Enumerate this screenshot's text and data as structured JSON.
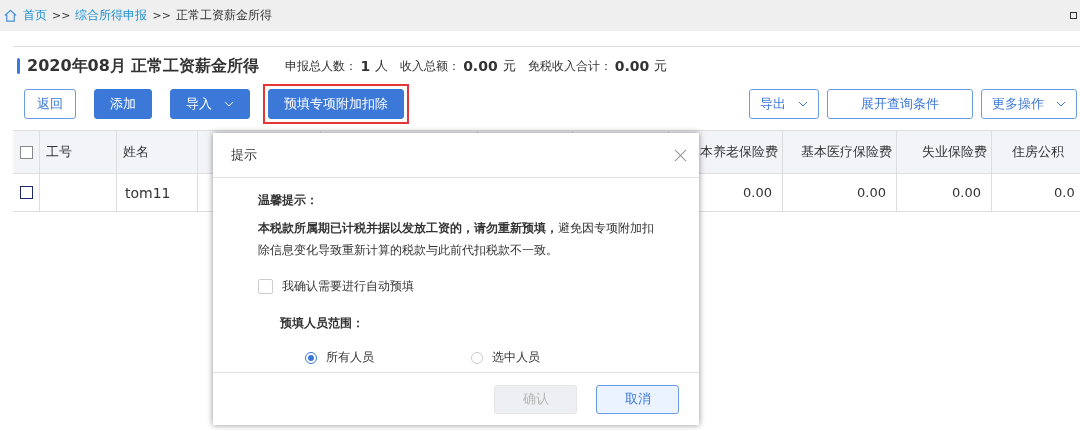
{
  "breadcrumb": [
    {
      "label": "首页",
      "link": true
    },
    {
      "label": "综合所得申报",
      "link": true
    },
    {
      "label": "正常工资薪金所得",
      "link": false
    }
  ],
  "breadcrumb_separator": ">>",
  "title": "2020年08月 正常工资薪金所得",
  "stats": [
    {
      "label": "申报总人数：",
      "value": "1",
      "unit": "人"
    },
    {
      "label": "收入总额：",
      "value": "0.00",
      "unit": "元"
    },
    {
      "label": "免税收入合计：",
      "value": "0.00",
      "unit": "元"
    }
  ],
  "left_buttons": [
    {
      "label": "返回",
      "kind": "outline",
      "dropdown": false,
      "highlighted": false
    },
    {
      "label": "添加",
      "kind": "primary",
      "dropdown": false,
      "highlighted": false
    },
    {
      "label": "导入",
      "kind": "primary",
      "dropdown": true,
      "highlighted": false
    },
    {
      "label": "预填专项附加扣除",
      "kind": "primary",
      "dropdown": false,
      "highlighted": true
    }
  ],
  "right_buttons": [
    {
      "label": "导出",
      "dropdown": true
    },
    {
      "label": "展开查询条件",
      "dropdown": false
    },
    {
      "label": "更多操作",
      "dropdown": true
    }
  ],
  "table": {
    "header_checked": false,
    "columns": [
      {
        "label": "工号"
      },
      {
        "label": "姓名"
      },
      {
        "label": "本养老保险费"
      },
      {
        "label": "基本医疗保险费"
      },
      {
        "label": "失业保险费"
      },
      {
        "label": "住房公积"
      }
    ],
    "rows": [
      {
        "checked": false,
        "name": "tom11",
        "values": [
          "0.00",
          "0.00",
          "0.00",
          "0.0"
        ]
      }
    ]
  },
  "dialog": {
    "title": "提示",
    "heading": "温馨提示：",
    "message": "**本税款所属期已计税并据以发放工资的，请勿重新预填，**避免因专项附加扣除信息变化导致重新计算的税款与此前代扣税款不一致。",
    "confirm_checkbox": {
      "label": "我确认需要进行自动预填",
      "checked": false
    },
    "scope_label": "预填人员范围：",
    "scope_options": [
      {
        "label": "所有人员",
        "selected": true
      },
      {
        "label": "选中人员",
        "selected": false
      }
    ],
    "buttons": [
      {
        "label": "确认",
        "kind": "primary",
        "disabled": true
      },
      {
        "label": "取消",
        "kind": "secondary",
        "disabled": false
      }
    ]
  }
}
